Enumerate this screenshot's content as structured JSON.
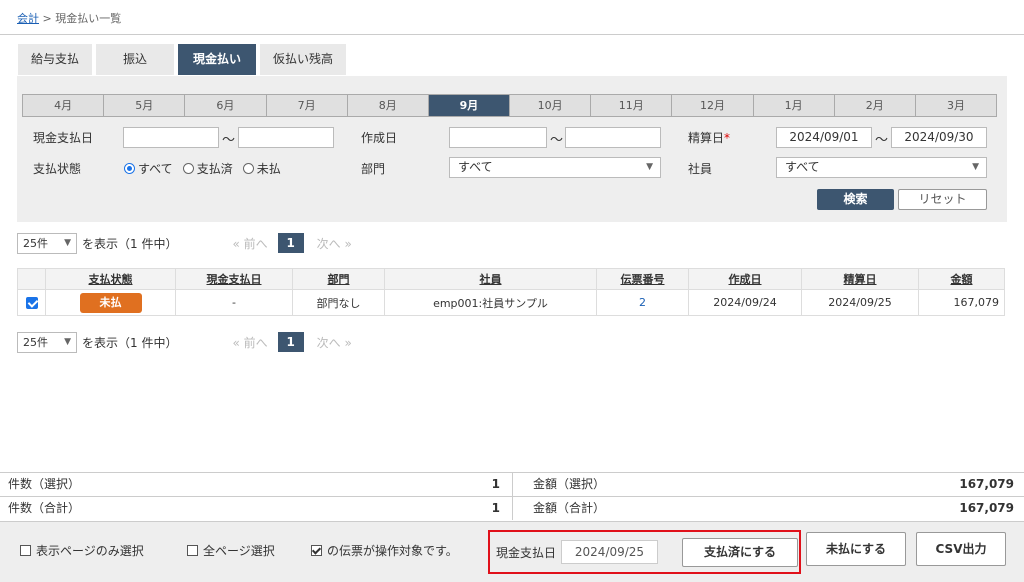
{
  "breadcrumb": {
    "root": "会計",
    "sep": ">",
    "current": "現金払い一覧"
  },
  "tabs": [
    {
      "label": "給与支払",
      "active": false
    },
    {
      "label": "振込",
      "active": false
    },
    {
      "label": "現金払い",
      "active": true
    },
    {
      "label": "仮払い残高",
      "active": false
    }
  ],
  "months": [
    "4月",
    "5月",
    "6月",
    "7月",
    "8月",
    "9月",
    "10月",
    "11月",
    "12月",
    "1月",
    "2月",
    "3月"
  ],
  "active_month": "9月",
  "filters": {
    "cash_date_label": "現金支払日",
    "cash_date_from": "",
    "cash_date_to": "",
    "tilde": "〜",
    "created_label": "作成日",
    "created_from": "",
    "created_to": "",
    "settle_label": "精算日",
    "required_mark": "*",
    "settle_from": "2024/09/01",
    "settle_to": "2024/09/30",
    "status_label": "支払状態",
    "status_all": "すべて",
    "status_paid": "支払済",
    "status_unpaid": "未払",
    "dept_label": "部門",
    "dept_value": "すべて",
    "employee_label": "社員",
    "employee_value": "すべて",
    "caret": "▼",
    "search": "検索",
    "reset": "リセット"
  },
  "pager": {
    "per_page": "25件",
    "caret": "▼",
    "info": "を表示（1 件中）",
    "prev": "« 前へ",
    "page": "1",
    "next": "次へ »"
  },
  "table": {
    "headers": [
      "支払状態",
      "現金支払日",
      "部門",
      "社員",
      "伝票番号",
      "作成日",
      "精算日",
      "金額"
    ],
    "rows": [
      {
        "status": "未払",
        "cash_date": "-",
        "dept": "部門なし",
        "employee": "emp001:社員サンプル",
        "slip": "2",
        "created": "2024/09/24",
        "settled": "2024/09/25",
        "amount": "167,079"
      }
    ]
  },
  "summary": {
    "count_selected_label": "件数（選択）",
    "count_selected": "1",
    "amount_selected_label": "金額（選択）",
    "amount_selected": "167,079",
    "count_total_label": "件数（合計）",
    "count_total": "1",
    "amount_total_label": "金額（合計）",
    "amount_total": "167,079"
  },
  "footer": {
    "page_only": "表示ページのみ選択",
    "all_pages": "全ページ選択",
    "target_note": "の伝票が操作対象です。",
    "cash_date_label": "現金支払日",
    "cash_date": "2024/09/25",
    "mark_paid": "支払済にする",
    "mark_unpaid": "未払にする",
    "csv": "CSV出力"
  },
  "colors": {
    "accent": "#3d5670",
    "badge_unpaid": "#e07020",
    "highlight": "#e0101a"
  }
}
